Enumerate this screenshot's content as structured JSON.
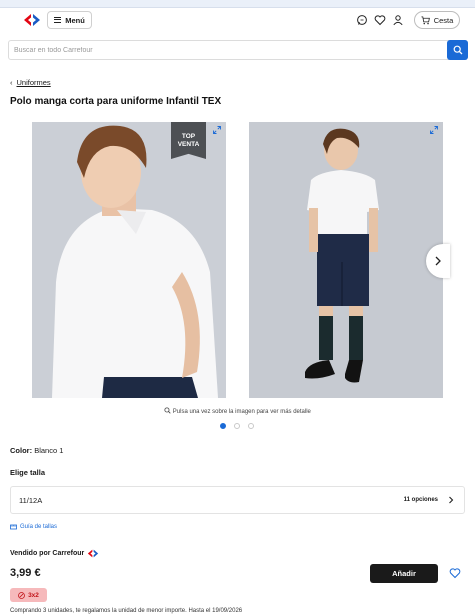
{
  "header": {
    "menu_label": "Menú",
    "cart_label": "Cesta",
    "icons": [
      "carrefour-logo",
      "chat-icon",
      "heart-icon",
      "user-icon",
      "cart-icon"
    ]
  },
  "search": {
    "placeholder": "Buscar en todo Carrefour"
  },
  "breadcrumb": {
    "label": "Uniformes"
  },
  "product": {
    "title": "Polo manga corta para uniforme Infantil TEX",
    "badge_line1": "TOP",
    "badge_line2": "VENTA",
    "image_hint": "Pulsa una vez sobre la imagen para ver más detalle",
    "carousel": {
      "total": 3,
      "active": 1
    },
    "color_label": "Color:",
    "color_value": "Blanco 1",
    "size_label": "Elige talla",
    "size_value": "11/12A",
    "size_options": "11 opciones",
    "size_guide": "Guía de tallas",
    "seller": "Vendido por Carrefour",
    "price": "3,99 €",
    "add_label": "Añadir",
    "promo_badge": "3x2",
    "promo_text": "Comprando 3 unidades, te regalamos la unidad de menor importe. Hasta el 19/09/2026"
  },
  "colors": {
    "accent_blue": "#1a6ad6",
    "carrefour_red": "#e30613",
    "add_button": "#1a1a1a",
    "promo_bg": "#f6b9bb",
    "promo_fg": "#c2151b"
  }
}
